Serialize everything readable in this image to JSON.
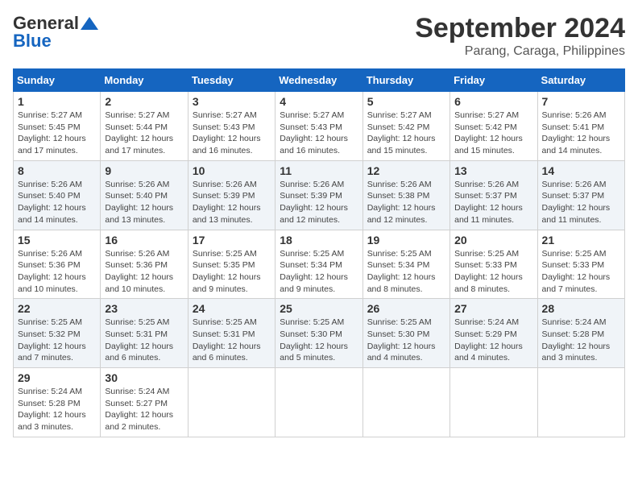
{
  "logo": {
    "general": "General",
    "blue": "Blue"
  },
  "header": {
    "month": "September 2024",
    "location": "Parang, Caraga, Philippines"
  },
  "columns": [
    "Sunday",
    "Monday",
    "Tuesday",
    "Wednesday",
    "Thursday",
    "Friday",
    "Saturday"
  ],
  "weeks": [
    [
      {
        "day": "1",
        "info": "Sunrise: 5:27 AM\nSunset: 5:45 PM\nDaylight: 12 hours\nand 17 minutes."
      },
      {
        "day": "2",
        "info": "Sunrise: 5:27 AM\nSunset: 5:44 PM\nDaylight: 12 hours\nand 17 minutes."
      },
      {
        "day": "3",
        "info": "Sunrise: 5:27 AM\nSunset: 5:43 PM\nDaylight: 12 hours\nand 16 minutes."
      },
      {
        "day": "4",
        "info": "Sunrise: 5:27 AM\nSunset: 5:43 PM\nDaylight: 12 hours\nand 16 minutes."
      },
      {
        "day": "5",
        "info": "Sunrise: 5:27 AM\nSunset: 5:42 PM\nDaylight: 12 hours\nand 15 minutes."
      },
      {
        "day": "6",
        "info": "Sunrise: 5:27 AM\nSunset: 5:42 PM\nDaylight: 12 hours\nand 15 minutes."
      },
      {
        "day": "7",
        "info": "Sunrise: 5:26 AM\nSunset: 5:41 PM\nDaylight: 12 hours\nand 14 minutes."
      }
    ],
    [
      {
        "day": "8",
        "info": "Sunrise: 5:26 AM\nSunset: 5:40 PM\nDaylight: 12 hours\nand 14 minutes."
      },
      {
        "day": "9",
        "info": "Sunrise: 5:26 AM\nSunset: 5:40 PM\nDaylight: 12 hours\nand 13 minutes."
      },
      {
        "day": "10",
        "info": "Sunrise: 5:26 AM\nSunset: 5:39 PM\nDaylight: 12 hours\nand 13 minutes."
      },
      {
        "day": "11",
        "info": "Sunrise: 5:26 AM\nSunset: 5:39 PM\nDaylight: 12 hours\nand 12 minutes."
      },
      {
        "day": "12",
        "info": "Sunrise: 5:26 AM\nSunset: 5:38 PM\nDaylight: 12 hours\nand 12 minutes."
      },
      {
        "day": "13",
        "info": "Sunrise: 5:26 AM\nSunset: 5:37 PM\nDaylight: 12 hours\nand 11 minutes."
      },
      {
        "day": "14",
        "info": "Sunrise: 5:26 AM\nSunset: 5:37 PM\nDaylight: 12 hours\nand 11 minutes."
      }
    ],
    [
      {
        "day": "15",
        "info": "Sunrise: 5:26 AM\nSunset: 5:36 PM\nDaylight: 12 hours\nand 10 minutes."
      },
      {
        "day": "16",
        "info": "Sunrise: 5:26 AM\nSunset: 5:36 PM\nDaylight: 12 hours\nand 10 minutes."
      },
      {
        "day": "17",
        "info": "Sunrise: 5:25 AM\nSunset: 5:35 PM\nDaylight: 12 hours\nand 9 minutes."
      },
      {
        "day": "18",
        "info": "Sunrise: 5:25 AM\nSunset: 5:34 PM\nDaylight: 12 hours\nand 9 minutes."
      },
      {
        "day": "19",
        "info": "Sunrise: 5:25 AM\nSunset: 5:34 PM\nDaylight: 12 hours\nand 8 minutes."
      },
      {
        "day": "20",
        "info": "Sunrise: 5:25 AM\nSunset: 5:33 PM\nDaylight: 12 hours\nand 8 minutes."
      },
      {
        "day": "21",
        "info": "Sunrise: 5:25 AM\nSunset: 5:33 PM\nDaylight: 12 hours\nand 7 minutes."
      }
    ],
    [
      {
        "day": "22",
        "info": "Sunrise: 5:25 AM\nSunset: 5:32 PM\nDaylight: 12 hours\nand 7 minutes."
      },
      {
        "day": "23",
        "info": "Sunrise: 5:25 AM\nSunset: 5:31 PM\nDaylight: 12 hours\nand 6 minutes."
      },
      {
        "day": "24",
        "info": "Sunrise: 5:25 AM\nSunset: 5:31 PM\nDaylight: 12 hours\nand 6 minutes."
      },
      {
        "day": "25",
        "info": "Sunrise: 5:25 AM\nSunset: 5:30 PM\nDaylight: 12 hours\nand 5 minutes."
      },
      {
        "day": "26",
        "info": "Sunrise: 5:25 AM\nSunset: 5:30 PM\nDaylight: 12 hours\nand 4 minutes."
      },
      {
        "day": "27",
        "info": "Sunrise: 5:24 AM\nSunset: 5:29 PM\nDaylight: 12 hours\nand 4 minutes."
      },
      {
        "day": "28",
        "info": "Sunrise: 5:24 AM\nSunset: 5:28 PM\nDaylight: 12 hours\nand 3 minutes."
      }
    ],
    [
      {
        "day": "29",
        "info": "Sunrise: 5:24 AM\nSunset: 5:28 PM\nDaylight: 12 hours\nand 3 minutes."
      },
      {
        "day": "30",
        "info": "Sunrise: 5:24 AM\nSunset: 5:27 PM\nDaylight: 12 hours\nand 2 minutes."
      },
      null,
      null,
      null,
      null,
      null
    ]
  ]
}
